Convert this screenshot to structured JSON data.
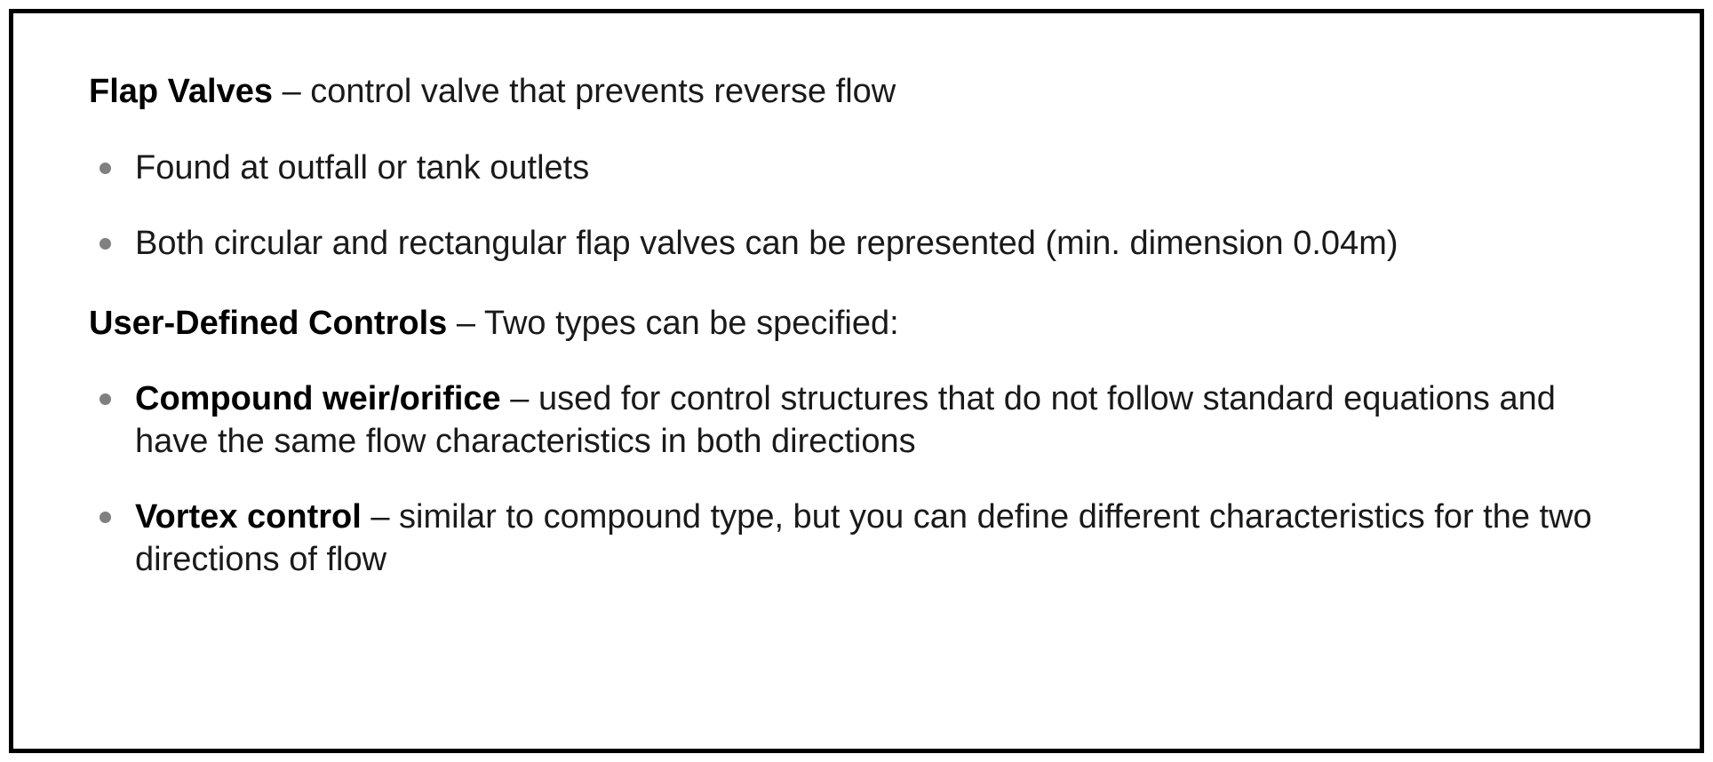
{
  "section1": {
    "heading_bold": "Flap Valves",
    "heading_rest": " – control valve that prevents reverse flow",
    "bullets": [
      "Found at outfall or tank outlets",
      "Both circular and rectangular flap valves can be represented (min. dimension 0.04m)"
    ]
  },
  "section2": {
    "heading_bold": "User-Defined Controls",
    "heading_rest": " – Two types can be specified:",
    "bullets": [
      {
        "bold": "Compound weir/orifice",
        "rest": " – used for control structures that do not follow standard equations and have the same flow characteristics in both directions"
      },
      {
        "bold": "Vortex control",
        "rest": " – similar to compound type, but you can define different characteristics for the two directions of flow"
      }
    ]
  }
}
